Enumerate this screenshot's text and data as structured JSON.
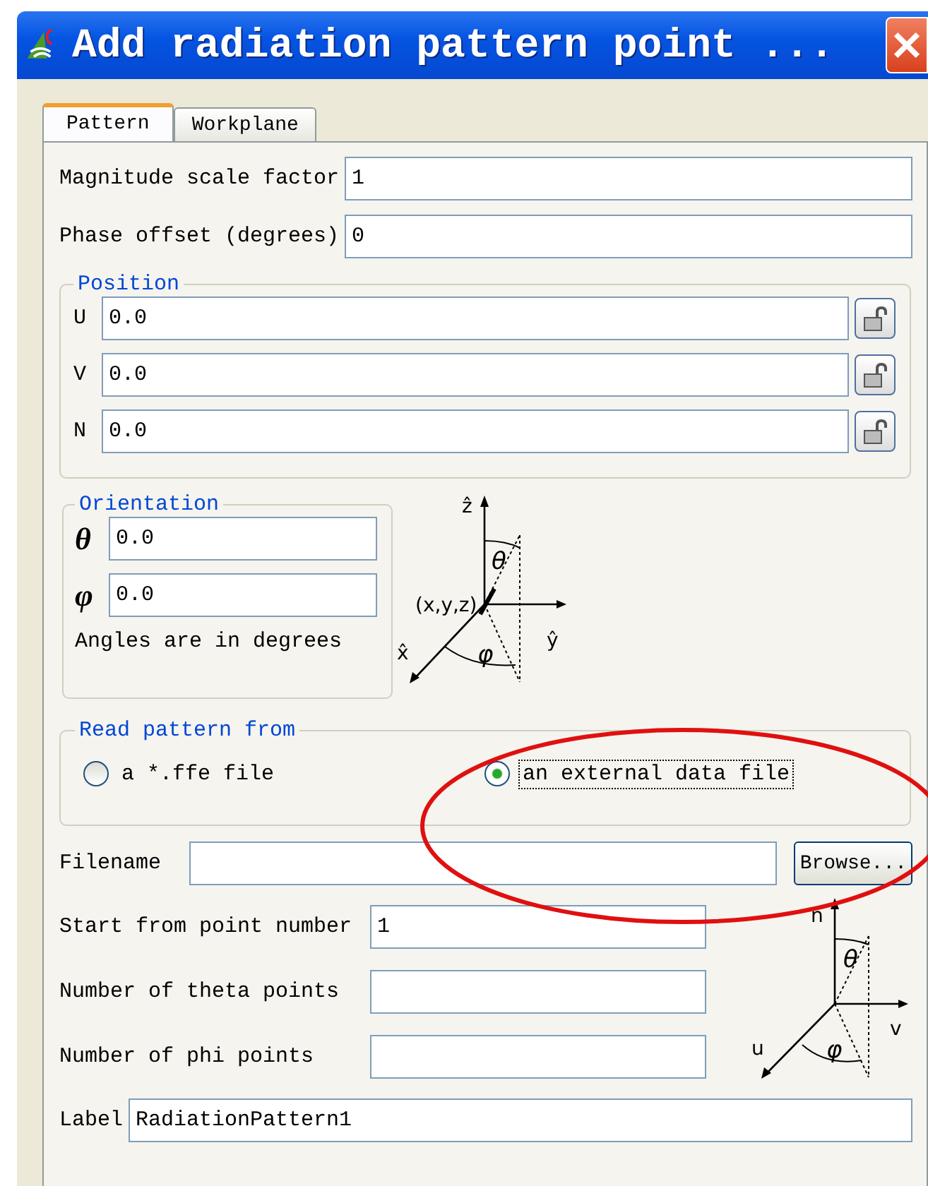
{
  "window": {
    "title": "Add radiation pattern point ..."
  },
  "tabs": [
    {
      "label": "Pattern",
      "selected": true
    },
    {
      "label": "Workplane",
      "selected": false
    }
  ],
  "fields": [
    {
      "label": "Magnitude scale factor",
      "value": "1"
    },
    {
      "label": "Phase offset (degrees)",
      "value": "0"
    }
  ],
  "position": {
    "title": "Position",
    "rows": [
      {
        "label": "U",
        "value": "0.0"
      },
      {
        "label": "V",
        "value": "0.0"
      },
      {
        "label": "N",
        "value": "0.0"
      }
    ]
  },
  "orientation": {
    "title": "Orientation",
    "rows": [
      {
        "label": "θ",
        "value": "0.0"
      },
      {
        "label": "φ",
        "value": "0.0"
      }
    ],
    "note": "Angles are in degrees",
    "diagram": {
      "z": "ẑ",
      "theta": "θ",
      "point": "(x,y,z)",
      "y": "ŷ",
      "x": "x̂",
      "phi": "φ"
    }
  },
  "read_pattern": {
    "title": "Read pattern from",
    "options": [
      {
        "label": "a *.ffe file",
        "selected": false
      },
      {
        "label": "an external data file",
        "selected": true
      }
    ]
  },
  "filename": {
    "label": "Filename",
    "button": "Browse..."
  },
  "point_fields": [
    {
      "label": "Start from point number",
      "value": "1"
    },
    {
      "label": "Number of theta points"
    },
    {
      "label": "Number of phi points"
    }
  ],
  "workplane_diagram": {
    "n": "n",
    "theta": "θ",
    "v": "v",
    "u": "u",
    "phi": "φ"
  },
  "label_field": {
    "label": "Label",
    "value": "RadiationPattern1"
  }
}
